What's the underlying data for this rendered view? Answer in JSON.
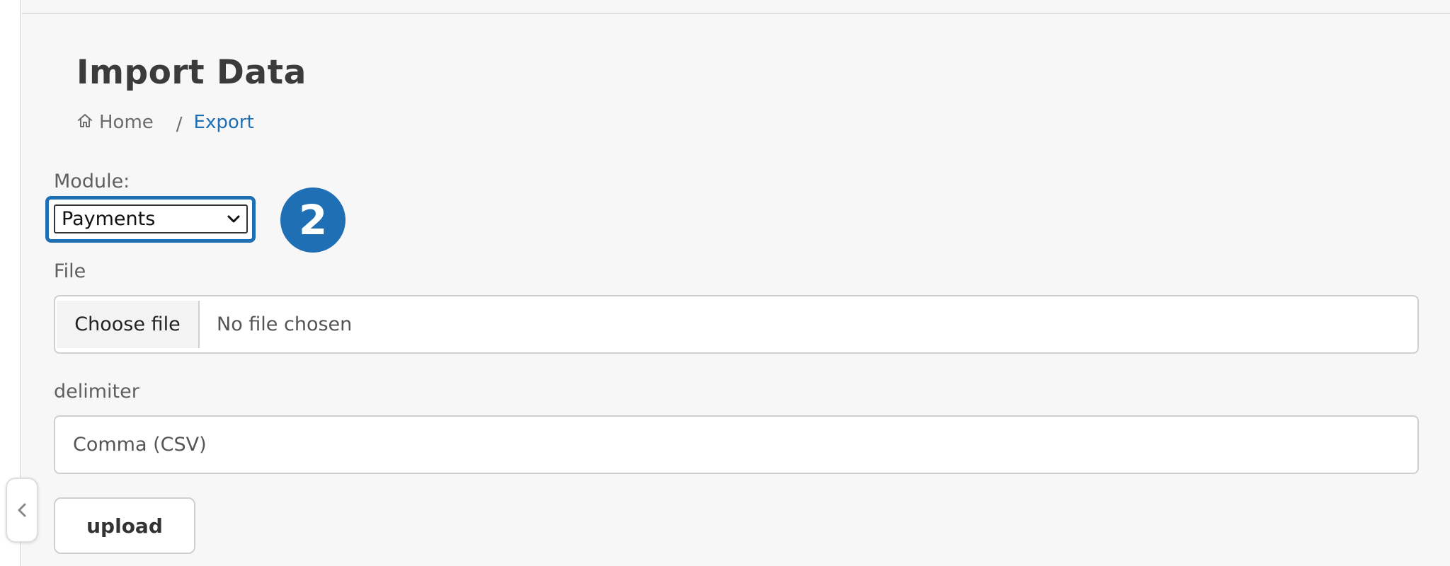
{
  "page": {
    "title": "Import Data"
  },
  "breadcrumb": {
    "home_label": "Home",
    "separator": "/",
    "current_label": "Export"
  },
  "form": {
    "module_label": "Module:",
    "module_value": "Payments",
    "step_badge": "2",
    "file_label": "File",
    "file_button_label": "Choose file",
    "file_status": "No file chosen",
    "delimiter_label": "delimiter",
    "delimiter_value": "Comma (CSV)",
    "upload_label": "upload"
  },
  "icons": {
    "home": "home-icon",
    "chevron_down": "chevron-down-icon",
    "chevron_left": "chevron-left-icon"
  },
  "colors": {
    "accent": "#1f6fb5",
    "background": "#f7f7f7",
    "border": "#cfcfcf"
  }
}
